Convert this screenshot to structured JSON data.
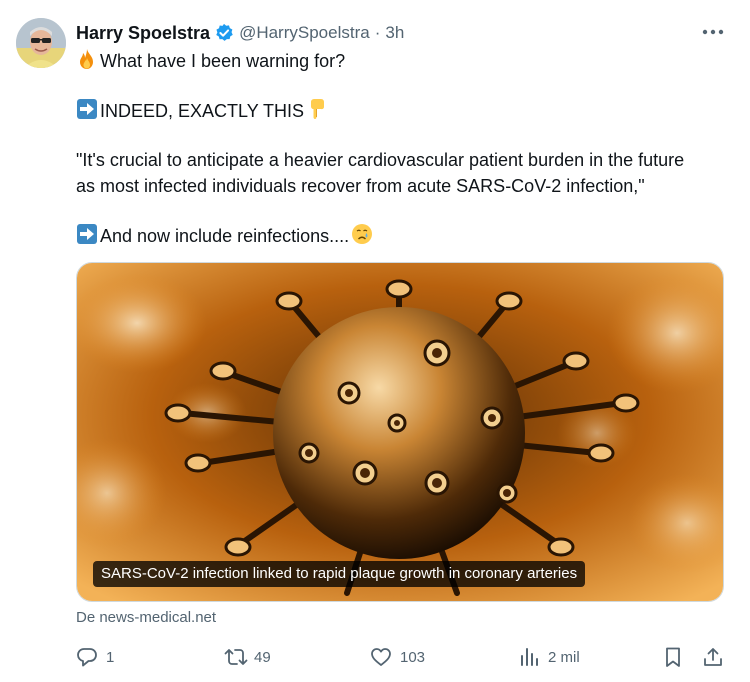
{
  "author": {
    "name": "Harry Spoelstra",
    "handle": "@HarrySpoelstra",
    "separator": "·",
    "time": "3h"
  },
  "tweet": {
    "line1": "What have I been warning for?",
    "line2": "INDEED, EXACTLY THIS",
    "line3": "\"It's crucial to anticipate a heavier cardiovascular patient burden in the future",
    "line4": "as most infected individuals recover from acute SARS-CoV-2 infection,\"",
    "line5": "And now include reinfections...."
  },
  "card": {
    "caption": "SARS-CoV-2 infection linked to rapid plaque growth in coronary arteries",
    "source": "De news-medical.net"
  },
  "actions": {
    "replies": "1",
    "retweets": "49",
    "likes": "103",
    "views": "2 mil"
  },
  "icons": {
    "verified": "verified-badge-icon",
    "fire": "fire-emoji",
    "arrow": "right-arrow-emoji",
    "pointing": "backhand-index-pointing-down-emoji",
    "crying": "crying-face-emoji"
  },
  "colors": {
    "text": "#0f1419",
    "secondary": "#536471",
    "verified": "#1d9bf0",
    "arrow_box": "#3b88c3",
    "virus_orange": "#e88a1a"
  }
}
